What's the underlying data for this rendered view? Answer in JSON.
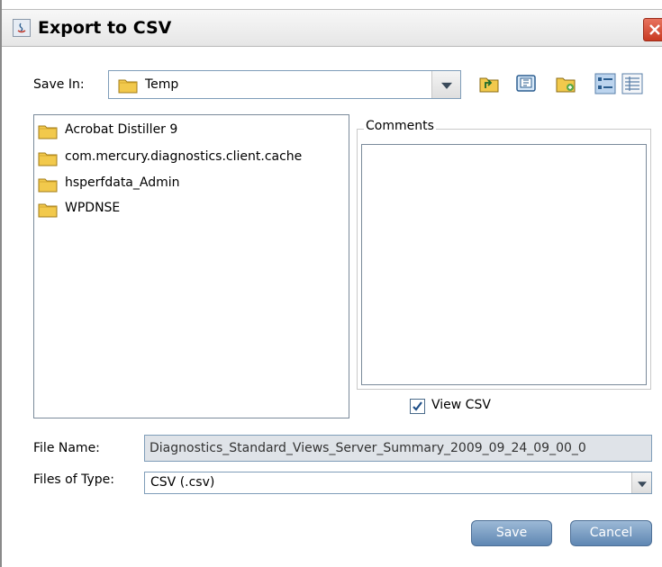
{
  "window": {
    "title": "Export to CSV"
  },
  "save_in": {
    "label": "Save In:",
    "value": "Temp",
    "toolbar": [
      "up-one-level-icon",
      "desktop-icon",
      "new-folder-icon",
      "list-view-icon",
      "details-view-icon"
    ]
  },
  "files": [
    {
      "name": "Acrobat Distiller 9",
      "icon": "folder-icon"
    },
    {
      "name": "com.mercury.diagnostics.client.cache",
      "icon": "folder-icon"
    },
    {
      "name": "hsperfdata_Admin",
      "icon": "folder-icon"
    },
    {
      "name": "WPDNSE",
      "icon": "folder-icon"
    }
  ],
  "comments": {
    "title": "Comments",
    "value": ""
  },
  "view_csv": {
    "label": "View CSV",
    "checked": true
  },
  "file_name": {
    "label": "File Name:",
    "value": "Diagnostics_Standard_Views_Server_Summary_2009_09_24_09_00_0"
  },
  "files_of_type": {
    "label": "Files of Type:",
    "value": "CSV (.csv)"
  },
  "buttons": {
    "save": "Save",
    "cancel": "Cancel"
  },
  "colors": {
    "button": "#7a9dc4",
    "close": "#d9533c",
    "folder": "#f2c94c"
  }
}
